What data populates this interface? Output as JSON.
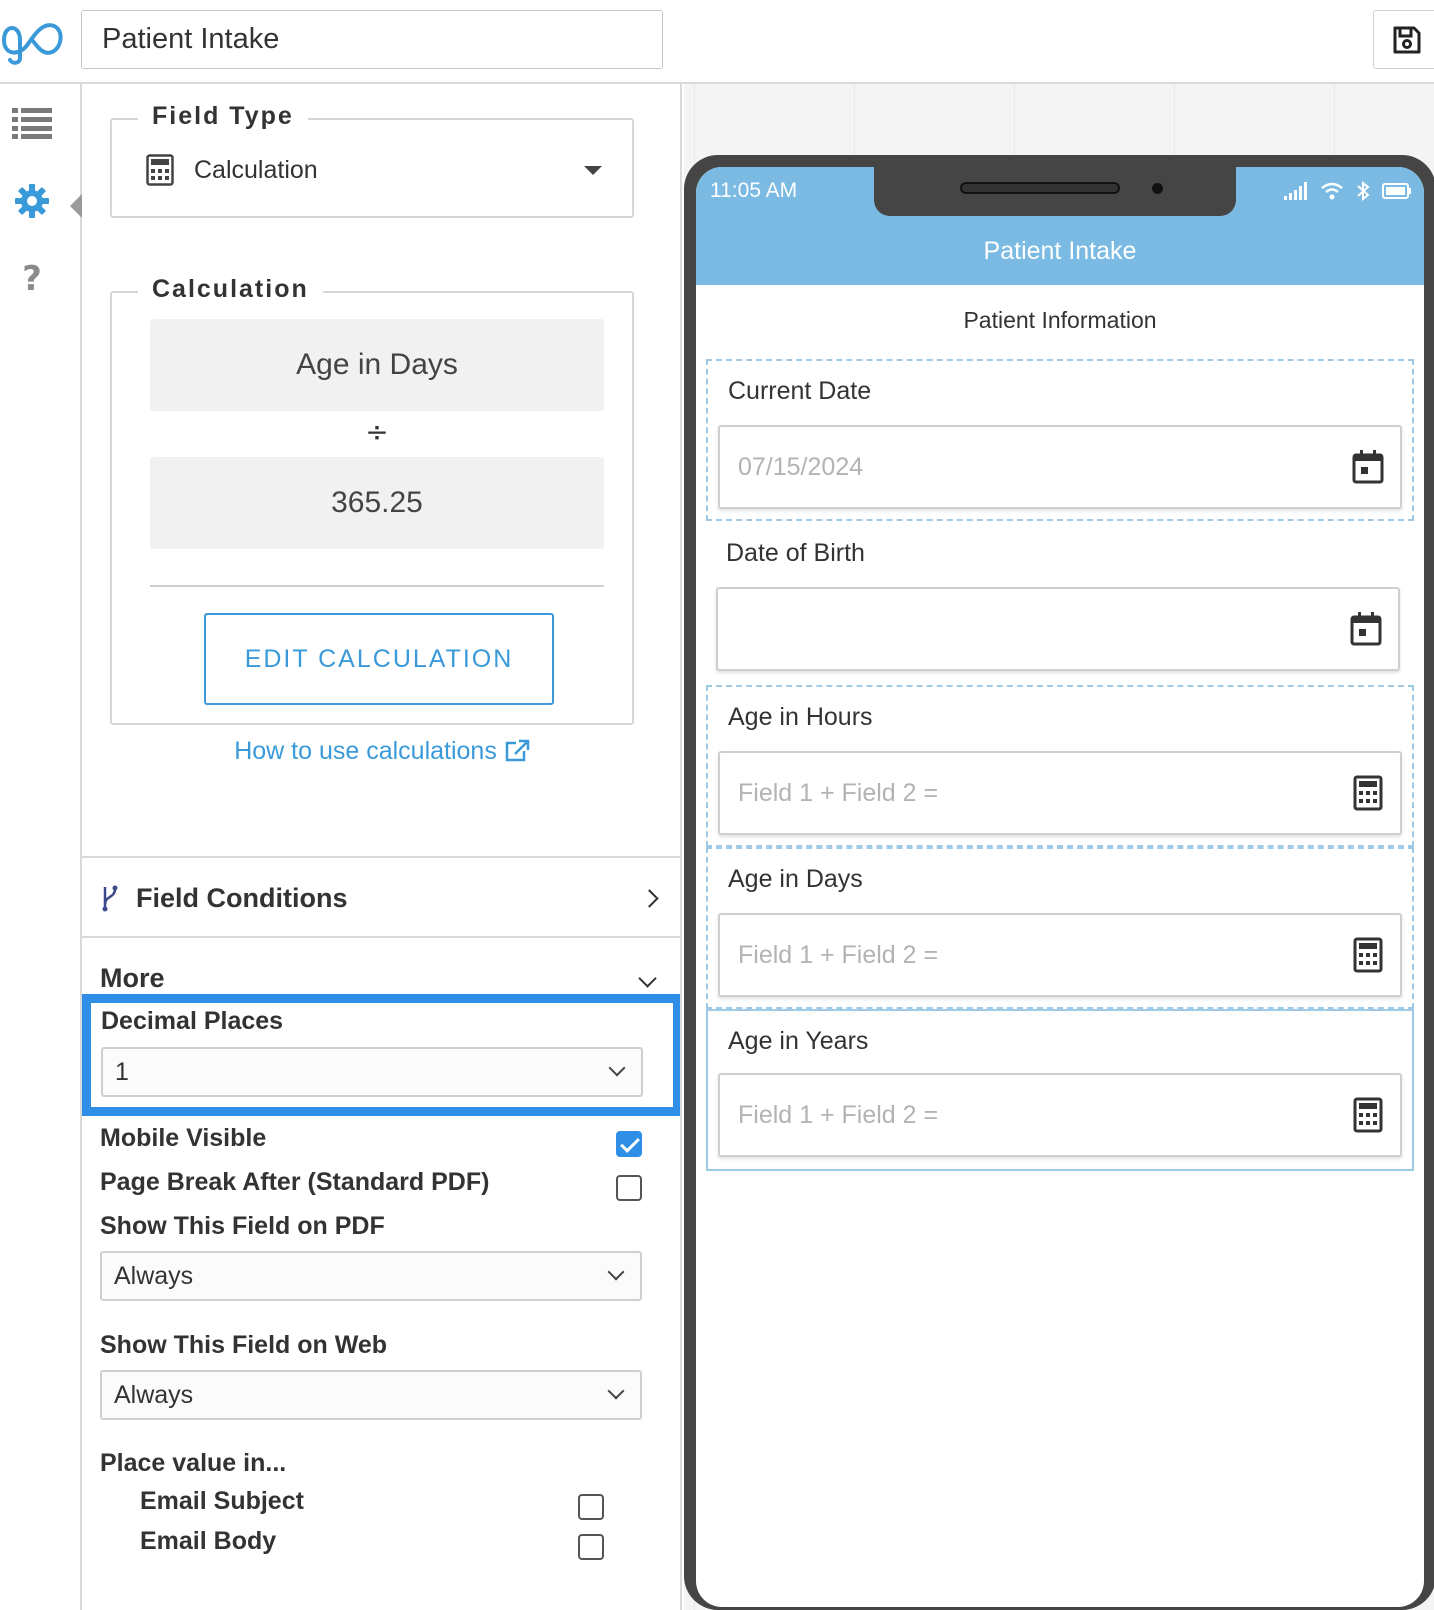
{
  "header": {
    "logo": "go-logo",
    "form_title": "Patient Intake",
    "save_icon": "save-icon"
  },
  "rail": {
    "items": [
      {
        "icon": "list-icon"
      },
      {
        "icon": "gear-icon",
        "active": true
      },
      {
        "icon": "help-icon",
        "label": "?"
      }
    ]
  },
  "panel": {
    "field_type": {
      "legend": "Field Type",
      "value": "Calculation",
      "icon": "calculator-icon"
    },
    "calculation": {
      "legend": "Calculation",
      "operand1": "Age in Days",
      "operator": "÷",
      "operand2": "365.25",
      "edit_button": "EDIT CALCULATION",
      "help_link": "How to use calculations"
    },
    "field_conditions": "Field Conditions",
    "more": "More",
    "decimal_places": {
      "label": "Decimal Places",
      "value": "1"
    },
    "mobile_visible": {
      "label": "Mobile Visible",
      "checked": true
    },
    "page_break_after": {
      "label": "Page Break After (Standard PDF)",
      "checked": false
    },
    "show_on_pdf": {
      "label": "Show This Field on PDF",
      "value": "Always"
    },
    "show_on_web": {
      "label": "Show This Field on Web",
      "value": "Always"
    },
    "place_value_in": {
      "label": "Place value in...",
      "options": [
        {
          "label": "Email Subject",
          "checked": false
        },
        {
          "label": "Email Body",
          "checked": false
        }
      ]
    }
  },
  "preview": {
    "status_time": "11:05 AM",
    "app_title": "Patient Intake",
    "section_title": "Patient Information",
    "fields": [
      {
        "label": "Current Date",
        "placeholder": "07/15/2024",
        "icon": "calendar-icon"
      },
      {
        "label": "Date of Birth",
        "placeholder": "",
        "icon": "calendar-icon"
      },
      {
        "label": "Age in Hours",
        "placeholder": "Field 1 + Field 2 =",
        "icon": "calculator-icon"
      },
      {
        "label": "Age in Days",
        "placeholder": "Field 1 + Field 2 =",
        "icon": "calculator-icon"
      },
      {
        "label": "Age in Years",
        "placeholder": "Field 1 + Field 2 =",
        "icon": "calculator-icon"
      }
    ]
  },
  "colors": {
    "accent": "#3a9ad9",
    "highlight_border": "#2f8ee6",
    "phone_header": "#7bbbe3",
    "phone_frame": "#454545"
  }
}
